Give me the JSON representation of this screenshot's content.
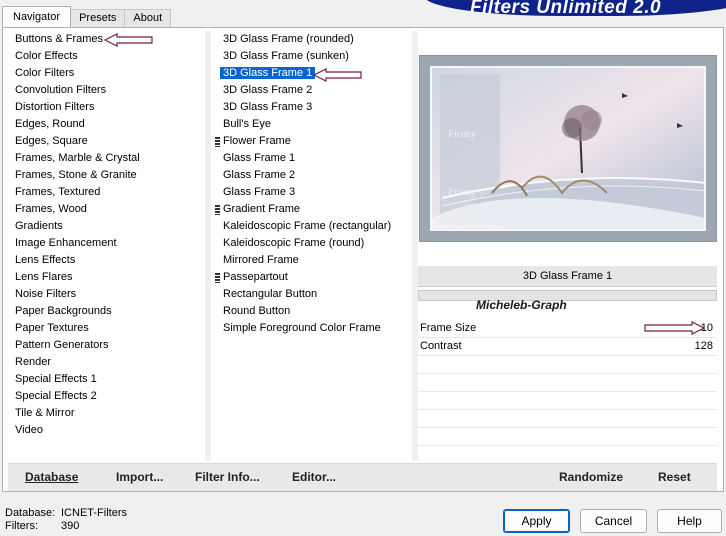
{
  "tabs": [
    {
      "label": "Navigator",
      "active": true
    },
    {
      "label": "Presets",
      "active": false
    },
    {
      "label": "About",
      "active": false
    }
  ],
  "banner_title": "Filters Unlimited 2.0",
  "categories": [
    "Buttons & Frames",
    "Color Effects",
    "Color Filters",
    "Convolution Filters",
    "Distortion Filters",
    "Edges, Round",
    "Edges, Square",
    "Frames, Marble & Crystal",
    "Frames, Stone & Granite",
    "Frames, Textured",
    "Frames, Wood",
    "Gradients",
    "Image Enhancement",
    "Lens Effects",
    "Lens Flares",
    "Noise Filters",
    "Paper Backgrounds",
    "Paper Textures",
    "Pattern Generators",
    "Render",
    "Special Effects 1",
    "Special Effects 2",
    "Tile & Mirror",
    "Video"
  ],
  "filters": [
    {
      "label": "3D Glass Frame (rounded)",
      "marker": false
    },
    {
      "label": "3D Glass Frame (sunken)",
      "marker": false
    },
    {
      "label": "3D Glass Frame 1",
      "marker": false,
      "selected": true
    },
    {
      "label": "3D Glass Frame 2",
      "marker": false
    },
    {
      "label": "3D Glass Frame 3",
      "marker": false
    },
    {
      "label": "Bull's Eye",
      "marker": false
    },
    {
      "label": "Flower Frame",
      "marker": true
    },
    {
      "label": "Glass Frame 1",
      "marker": false
    },
    {
      "label": "Glass Frame 2",
      "marker": false
    },
    {
      "label": "Glass Frame 3",
      "marker": false
    },
    {
      "label": "Gradient Frame",
      "marker": true
    },
    {
      "label": "Kaleidoscopic Frame (rectangular)",
      "marker": false
    },
    {
      "label": "Kaleidoscopic Frame (round)",
      "marker": false
    },
    {
      "label": "Mirrored Frame",
      "marker": false
    },
    {
      "label": "Passepartout",
      "marker": true
    },
    {
      "label": "Rectangular Button",
      "marker": false
    },
    {
      "label": "Round Button",
      "marker": false
    },
    {
      "label": "Simple Foreground Color Frame",
      "marker": false
    }
  ],
  "preview": {
    "filter_name": "3D Glass Frame 1",
    "watermark": "Micheleb-Graph",
    "thumb_texts": [
      "Frosty",
      "Frosty"
    ]
  },
  "params": [
    {
      "name": "Frame Size",
      "value": "10"
    },
    {
      "name": "Contrast",
      "value": "128"
    }
  ],
  "toolbar": {
    "database": "Database",
    "import": "Import...",
    "filter_info": "Filter Info...",
    "editor": "Editor...",
    "randomize": "Randomize",
    "reset": "Reset"
  },
  "status": {
    "database_label": "Database:",
    "database_value": "ICNET-Filters",
    "filters_label": "Filters:",
    "filters_value": "390"
  },
  "buttons": {
    "apply": "Apply",
    "cancel": "Cancel",
    "help": "Help"
  },
  "colors": {
    "selection": "#0a64d2",
    "banner": "#10238a",
    "annotation_arrow": "#7a1f35"
  }
}
